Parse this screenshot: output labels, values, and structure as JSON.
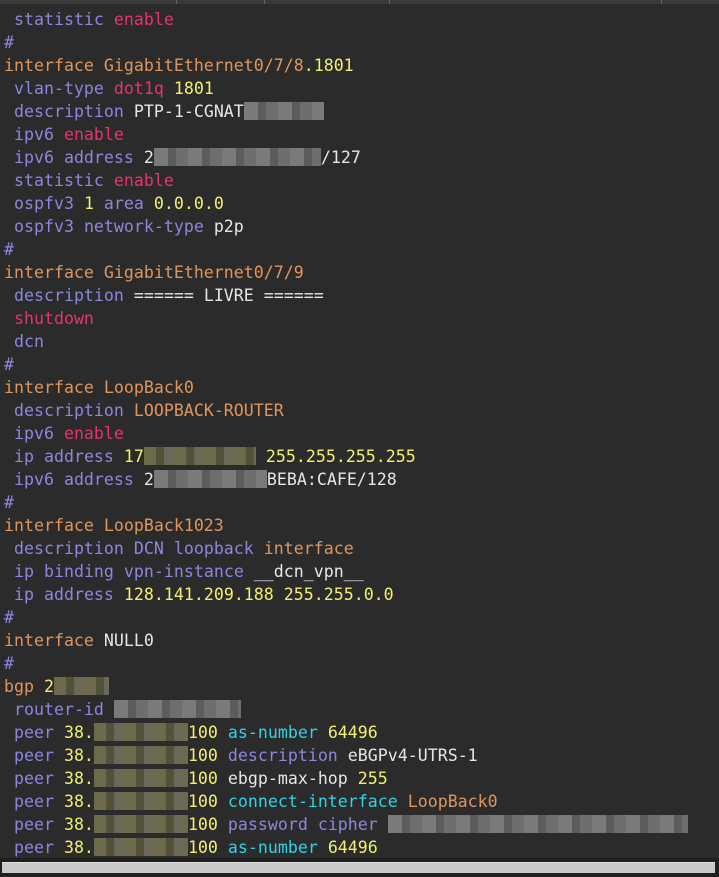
{
  "editor": {
    "lines": [
      {
        "indent": true,
        "tokens": [
          {
            "text": "statistic ",
            "style": "cmd"
          },
          {
            "text": "enable",
            "style": "kw"
          }
        ]
      },
      {
        "indent": false,
        "tokens": [
          {
            "text": "#",
            "style": "com"
          }
        ]
      },
      {
        "indent": false,
        "tokens": [
          {
            "text": "interface ",
            "style": "if"
          },
          {
            "text": "GigabitEthernet0/7/8",
            "style": "if"
          },
          {
            "text": ".1801",
            "style": "num"
          }
        ]
      },
      {
        "indent": true,
        "tokens": [
          {
            "text": "vlan-type ",
            "style": "cmd"
          },
          {
            "text": "dot1q ",
            "style": "kw"
          },
          {
            "text": "1801",
            "style": "num"
          }
        ]
      },
      {
        "indent": true,
        "tokens": [
          {
            "text": "description ",
            "style": "cmd"
          },
          {
            "text": "PTP-1-CGNAT",
            "style": "txt"
          },
          {
            "redact": 80
          }
        ]
      },
      {
        "indent": true,
        "tokens": [
          {
            "text": "ipv6 ",
            "style": "cmd"
          },
          {
            "text": "enable",
            "style": "kw"
          }
        ]
      },
      {
        "indent": true,
        "tokens": [
          {
            "text": "ipv6 ",
            "style": "cmd"
          },
          {
            "text": "address ",
            "style": "cmd"
          },
          {
            "text": "2",
            "style": "txt"
          },
          {
            "redact": 167
          },
          {
            "text": "/127",
            "style": "txt"
          }
        ]
      },
      {
        "indent": true,
        "tokens": [
          {
            "text": "statistic ",
            "style": "cmd"
          },
          {
            "text": "enable",
            "style": "kw"
          }
        ]
      },
      {
        "indent": true,
        "tokens": [
          {
            "text": "ospfv3 ",
            "style": "cmd"
          },
          {
            "text": "1 ",
            "style": "num"
          },
          {
            "text": "area ",
            "style": "cmd"
          },
          {
            "text": "0.0.0.0",
            "style": "num"
          }
        ]
      },
      {
        "indent": true,
        "tokens": [
          {
            "text": "ospfv3 ",
            "style": "cmd"
          },
          {
            "text": "network-type ",
            "style": "cmd"
          },
          {
            "text": "p2p",
            "style": "txt"
          }
        ]
      },
      {
        "indent": false,
        "tokens": [
          {
            "text": "#",
            "style": "com"
          }
        ]
      },
      {
        "indent": false,
        "tokens": [
          {
            "text": "interface ",
            "style": "if"
          },
          {
            "text": "GigabitEthernet0/7/9",
            "style": "if"
          }
        ]
      },
      {
        "indent": true,
        "tokens": [
          {
            "text": "description ",
            "style": "cmd"
          },
          {
            "text": "====== LIVRE ======",
            "style": "txt"
          }
        ]
      },
      {
        "indent": true,
        "tokens": [
          {
            "text": "shutdown",
            "style": "kw"
          }
        ]
      },
      {
        "indent": true,
        "tokens": [
          {
            "text": "dcn",
            "style": "cmd"
          }
        ]
      },
      {
        "indent": false,
        "tokens": [
          {
            "text": "#",
            "style": "com"
          }
        ]
      },
      {
        "indent": false,
        "tokens": [
          {
            "text": "interface ",
            "style": "if"
          },
          {
            "text": "LoopBack0",
            "style": "if"
          }
        ]
      },
      {
        "indent": true,
        "tokens": [
          {
            "text": "description ",
            "style": "cmd"
          },
          {
            "text": "LOOPBACK-ROUTER",
            "style": "if"
          }
        ]
      },
      {
        "indent": true,
        "tokens": [
          {
            "text": "ipv6 ",
            "style": "cmd"
          },
          {
            "text": "enable",
            "style": "kw"
          }
        ]
      },
      {
        "indent": true,
        "tokens": [
          {
            "text": "ip ",
            "style": "cmd"
          },
          {
            "text": "address ",
            "style": "cmd"
          },
          {
            "text": "17",
            "style": "num"
          },
          {
            "redact": 112,
            "olive": true
          },
          {
            "text": " 255.255.255.255",
            "style": "num"
          }
        ]
      },
      {
        "indent": true,
        "tokens": [
          {
            "text": "ipv6 ",
            "style": "cmd"
          },
          {
            "text": "address ",
            "style": "cmd"
          },
          {
            "text": "2",
            "style": "txt"
          },
          {
            "redact": 113
          },
          {
            "text": "BEBA:CAFE/128",
            "style": "txt"
          }
        ]
      },
      {
        "indent": false,
        "tokens": [
          {
            "text": "#",
            "style": "com"
          }
        ]
      },
      {
        "indent": false,
        "tokens": [
          {
            "text": "interface ",
            "style": "if"
          },
          {
            "text": "LoopBack1023",
            "style": "if"
          }
        ]
      },
      {
        "indent": true,
        "tokens": [
          {
            "text": "description ",
            "style": "cmd"
          },
          {
            "text": "DCN ",
            "style": "cmd"
          },
          {
            "text": "loopback ",
            "style": "cmd"
          },
          {
            "text": "interface",
            "style": "if"
          }
        ]
      },
      {
        "indent": true,
        "tokens": [
          {
            "text": "ip ",
            "style": "cmd"
          },
          {
            "text": "binding ",
            "style": "cmd"
          },
          {
            "text": "vpn-instance ",
            "style": "cmd"
          },
          {
            "text": "__dcn_vpn__",
            "style": "txt"
          }
        ]
      },
      {
        "indent": true,
        "tokens": [
          {
            "text": "ip ",
            "style": "cmd"
          },
          {
            "text": "address ",
            "style": "cmd"
          },
          {
            "text": "128.141.209.188 255.255.0.0",
            "style": "num"
          }
        ]
      },
      {
        "indent": false,
        "tokens": [
          {
            "text": "#",
            "style": "com"
          }
        ]
      },
      {
        "indent": false,
        "tokens": [
          {
            "text": "interface ",
            "style": "if"
          },
          {
            "text": "NULL0",
            "style": "txt"
          }
        ]
      },
      {
        "indent": false,
        "tokens": [
          {
            "text": "#",
            "style": "com"
          }
        ]
      },
      {
        "indent": false,
        "tokens": [
          {
            "text": "bgp ",
            "style": "if"
          },
          {
            "text": "2",
            "style": "num"
          },
          {
            "redact": 55,
            "olive": true
          }
        ]
      },
      {
        "indent": true,
        "tokens": [
          {
            "text": "router-id ",
            "style": "cmd"
          },
          {
            "redact": 127
          }
        ]
      },
      {
        "indent": true,
        "tokens": [
          {
            "text": "peer ",
            "style": "cmd"
          },
          {
            "text": "38.",
            "style": "num"
          },
          {
            "redact": 94,
            "olive": true
          },
          {
            "text": "100 ",
            "style": "num"
          },
          {
            "text": "as-number ",
            "style": "cy"
          },
          {
            "text": "64496",
            "style": "num"
          }
        ]
      },
      {
        "indent": true,
        "tokens": [
          {
            "text": "peer ",
            "style": "cmd"
          },
          {
            "text": "38.",
            "style": "num"
          },
          {
            "redact": 94,
            "olive": true
          },
          {
            "text": "100 ",
            "style": "num"
          },
          {
            "text": "description ",
            "style": "cmd"
          },
          {
            "text": "eBGPv4-UTRS-1",
            "style": "txt"
          }
        ]
      },
      {
        "indent": true,
        "tokens": [
          {
            "text": "peer ",
            "style": "cmd"
          },
          {
            "text": "38.",
            "style": "num"
          },
          {
            "redact": 94,
            "olive": true
          },
          {
            "text": "100 ",
            "style": "num"
          },
          {
            "text": "ebgp-max-hop ",
            "style": "txt"
          },
          {
            "text": "255",
            "style": "num"
          }
        ]
      },
      {
        "indent": true,
        "tokens": [
          {
            "text": "peer ",
            "style": "cmd"
          },
          {
            "text": "38.",
            "style": "num"
          },
          {
            "redact": 94,
            "olive": true
          },
          {
            "text": "100 ",
            "style": "num"
          },
          {
            "text": "connect-interface ",
            "style": "cy"
          },
          {
            "text": "LoopBack0",
            "style": "if"
          }
        ]
      },
      {
        "indent": true,
        "tokens": [
          {
            "text": "peer ",
            "style": "cmd"
          },
          {
            "text": "38.",
            "style": "num"
          },
          {
            "redact": 94,
            "olive": true
          },
          {
            "text": "100 ",
            "style": "num"
          },
          {
            "text": "password ",
            "style": "cmd"
          },
          {
            "text": "cipher ",
            "style": "cmd"
          },
          {
            "redact": 300
          }
        ]
      },
      {
        "indent": true,
        "tokens": [
          {
            "text": "peer ",
            "style": "cmd"
          },
          {
            "text": "38.",
            "style": "num"
          },
          {
            "redact": 94,
            "olive": true
          },
          {
            "text": "100 ",
            "style": "num"
          },
          {
            "text": "as-number ",
            "style": "cy"
          },
          {
            "text": "64496",
            "style": "num"
          }
        ]
      }
    ]
  }
}
